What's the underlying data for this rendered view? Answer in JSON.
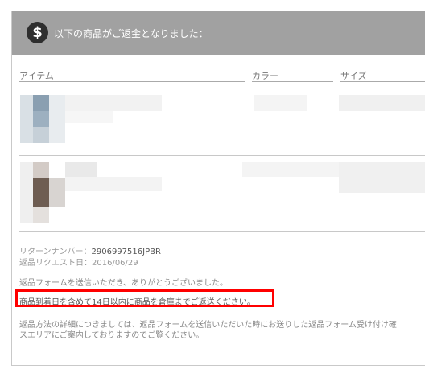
{
  "header": {
    "title": "以下の商品がご返金となりました：",
    "icon": "dollar-icon"
  },
  "columns": {
    "item": "アイテム",
    "color": "カラー",
    "size": "サイズ"
  },
  "info": {
    "return_number_label": "リターンナンバー：",
    "return_number_value": "2906997516JPBR",
    "request_date_label": "返品リクエスト日：",
    "request_date_value": "2016/06/29"
  },
  "messages": {
    "thanks": "返品フォームを送信いただき、ありがとうございました。",
    "notice": "商品到着日を含めて14日以内に商品を倉庫までご返送ください。",
    "details_line1": "返品方法の詳細につきましては、返品フォームを送信いただいた時にお送りした返品フォーム受け付け確",
    "details_line2": "スエリアにご案内しておりますのでご覧ください。"
  },
  "colors": {
    "header_bg": "#a1a1a1",
    "highlight": "#ff0000"
  }
}
